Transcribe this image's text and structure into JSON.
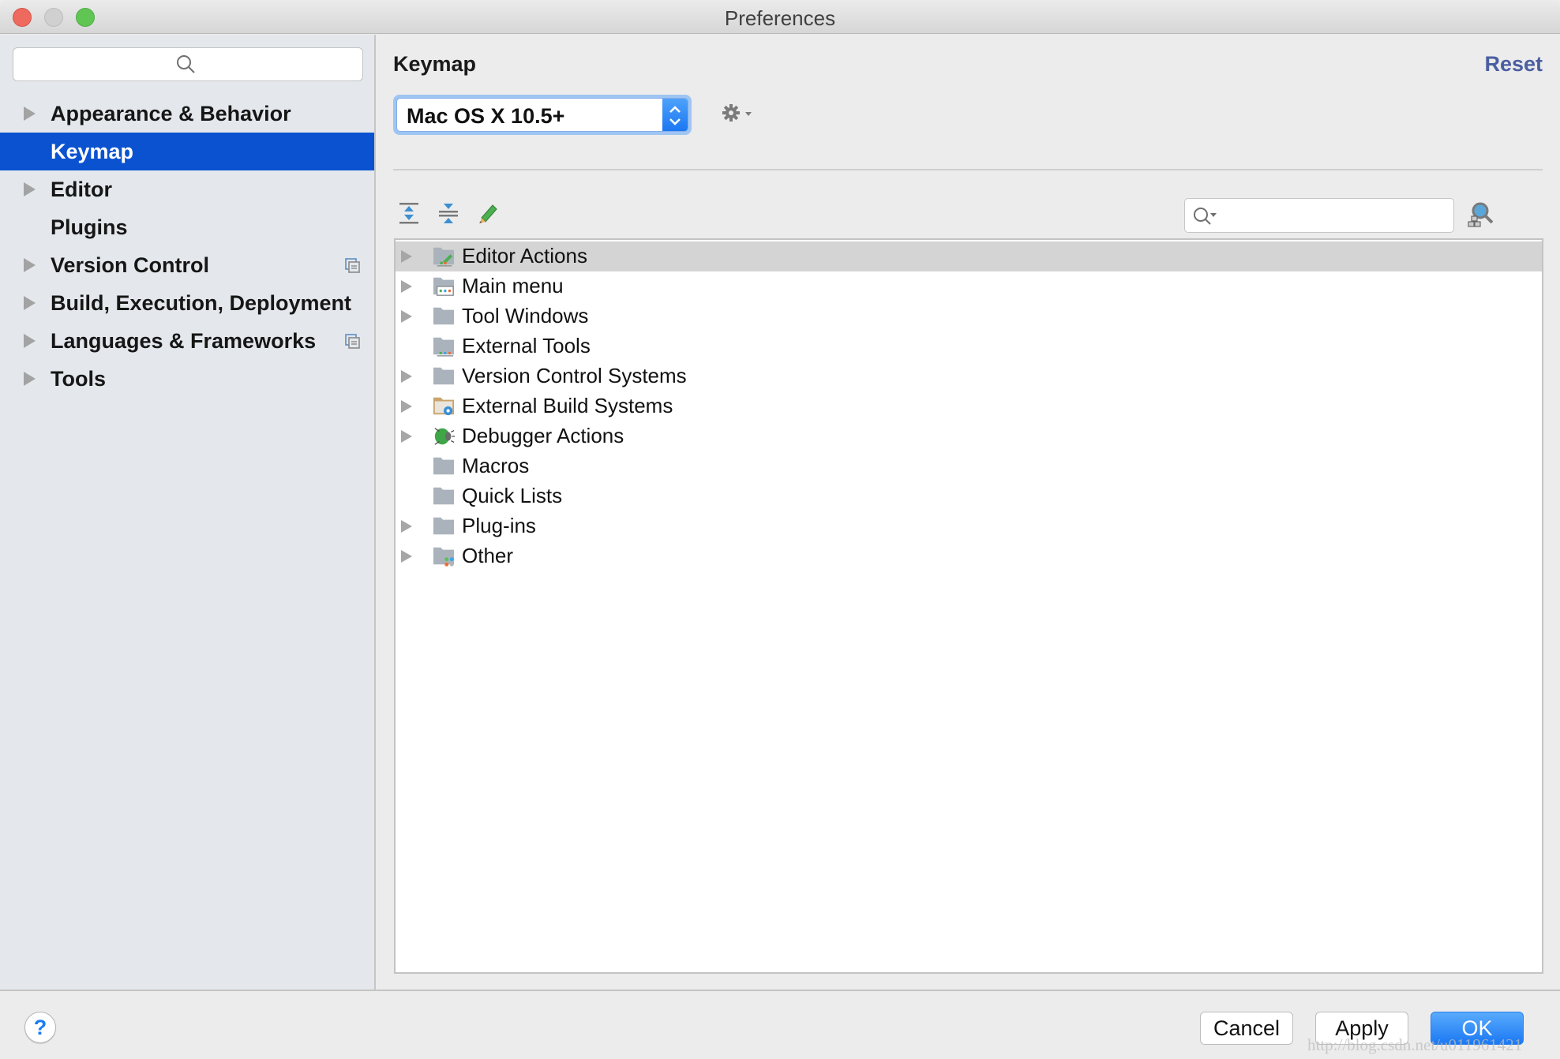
{
  "window": {
    "title": "Preferences",
    "controls": [
      "close",
      "minimize",
      "maximize"
    ]
  },
  "sidebar": {
    "search": {
      "placeholder": "",
      "value": "",
      "icon": "search-icon"
    },
    "items": [
      {
        "label": "Appearance & Behavior",
        "expandable": true,
        "selected": false,
        "project_icon": false
      },
      {
        "label": "Keymap",
        "expandable": false,
        "selected": true,
        "project_icon": false
      },
      {
        "label": "Editor",
        "expandable": true,
        "selected": false,
        "project_icon": false
      },
      {
        "label": "Plugins",
        "expandable": false,
        "selected": false,
        "project_icon": false
      },
      {
        "label": "Version Control",
        "expandable": true,
        "selected": false,
        "project_icon": true
      },
      {
        "label": "Build, Execution, Deployment",
        "expandable": true,
        "selected": false,
        "project_icon": false
      },
      {
        "label": "Languages & Frameworks",
        "expandable": true,
        "selected": false,
        "project_icon": true
      },
      {
        "label": "Tools",
        "expandable": true,
        "selected": false,
        "project_icon": false
      }
    ]
  },
  "main": {
    "heading": "Keymap",
    "reset_label": "Reset",
    "keymap_select": {
      "value": "Mac OS X 10.5+"
    },
    "settings_icon": "gear-icon",
    "toolbar": {
      "expand_all_icon": "expand-all-icon",
      "collapse_all_icon": "collapse-all-icon",
      "edit_icon": "pencil-icon"
    },
    "tree_search": {
      "placeholder": "",
      "value": ""
    },
    "find_shortcut_icon": "find-by-shortcut-icon",
    "tree": [
      {
        "label": "Editor Actions",
        "expandable": true,
        "selected": true,
        "icon": "editor-actions-folder-icon"
      },
      {
        "label": "Main menu",
        "expandable": true,
        "selected": false,
        "icon": "main-menu-folder-icon"
      },
      {
        "label": "Tool Windows",
        "expandable": true,
        "selected": false,
        "icon": "folder-icon"
      },
      {
        "label": "External Tools",
        "expandable": false,
        "selected": false,
        "icon": "external-tools-folder-icon"
      },
      {
        "label": "Version Control Systems",
        "expandable": true,
        "selected": false,
        "icon": "folder-icon"
      },
      {
        "label": "External Build Systems",
        "expandable": true,
        "selected": false,
        "icon": "build-systems-folder-icon"
      },
      {
        "label": "Debugger Actions",
        "expandable": true,
        "selected": false,
        "icon": "bug-icon"
      },
      {
        "label": "Macros",
        "expandable": false,
        "selected": false,
        "icon": "folder-icon"
      },
      {
        "label": "Quick Lists",
        "expandable": false,
        "selected": false,
        "icon": "folder-icon"
      },
      {
        "label": "Plug-ins",
        "expandable": true,
        "selected": false,
        "icon": "folder-icon"
      },
      {
        "label": "Other",
        "expandable": true,
        "selected": false,
        "icon": "other-folder-icon"
      }
    ]
  },
  "footer": {
    "help_label": "?",
    "cancel_label": "Cancel",
    "apply_label": "Apply",
    "ok_label": "OK",
    "watermark": "http://blog.csdn.net/u011961421"
  },
  "colors": {
    "selection": "#0b52d1",
    "reset_link": "#4a5ea1",
    "primary_button": "#1a78f3",
    "sidebar_bg": "#e4e8ec"
  }
}
